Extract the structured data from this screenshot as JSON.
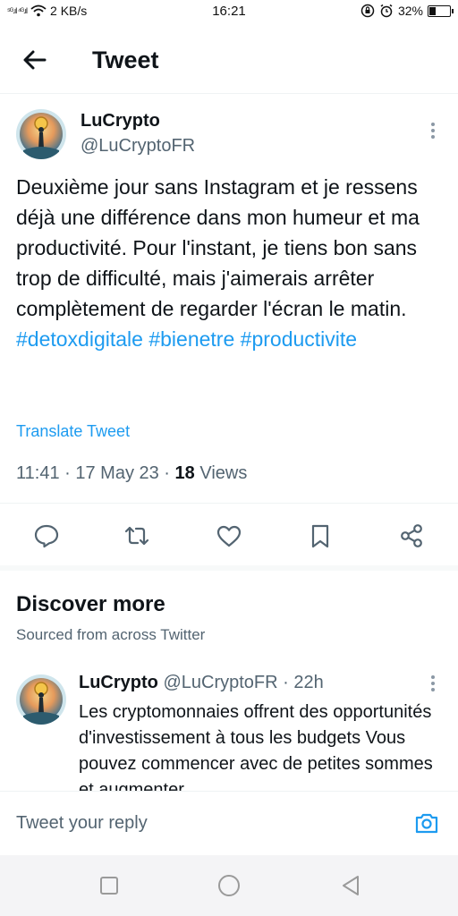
{
  "status_bar": {
    "signal": "⁵ᴳ.ıl ⁴ᴳ.ıl",
    "speed": "2 KB/s",
    "time": "16:21",
    "battery": "32%",
    "battery_level": 0.32
  },
  "header": {
    "title": "Tweet"
  },
  "tweet": {
    "author_name": "LuCrypto",
    "author_handle": "@LuCryptoFR",
    "text_plain": "Deuxième jour sans Instagram et je ressens déjà une différence dans mon humeur et ma productivité. Pour l'instant, je tiens bon sans trop de difficulté, mais j'aimerais arrêter complètement de regarder l'écran le matin.",
    "hashtag_1": "#detoxdigitale",
    "hashtag_2": "#bienetre",
    "hashtag_3": "#productivite",
    "translate_label": "Translate Tweet",
    "time": "11:41",
    "date": "17 May 23",
    "views_count": "18",
    "views_label": "Views"
  },
  "discover": {
    "title": "Discover more",
    "subtitle": "Sourced from across Twitter",
    "item": {
      "author_name": "LuCrypto",
      "author_handle": "@LuCryptoFR",
      "age": "22h",
      "text": "Les cryptomonnaies offrent des opportunités d'investissement à tous les budgets Vous pouvez commencer avec de petites sommes et augmenter"
    }
  },
  "reply": {
    "placeholder": "Tweet your reply"
  },
  "colors": {
    "accent": "#1d9bf0",
    "secondary_text": "#536471",
    "primary_text": "#0f1419"
  }
}
